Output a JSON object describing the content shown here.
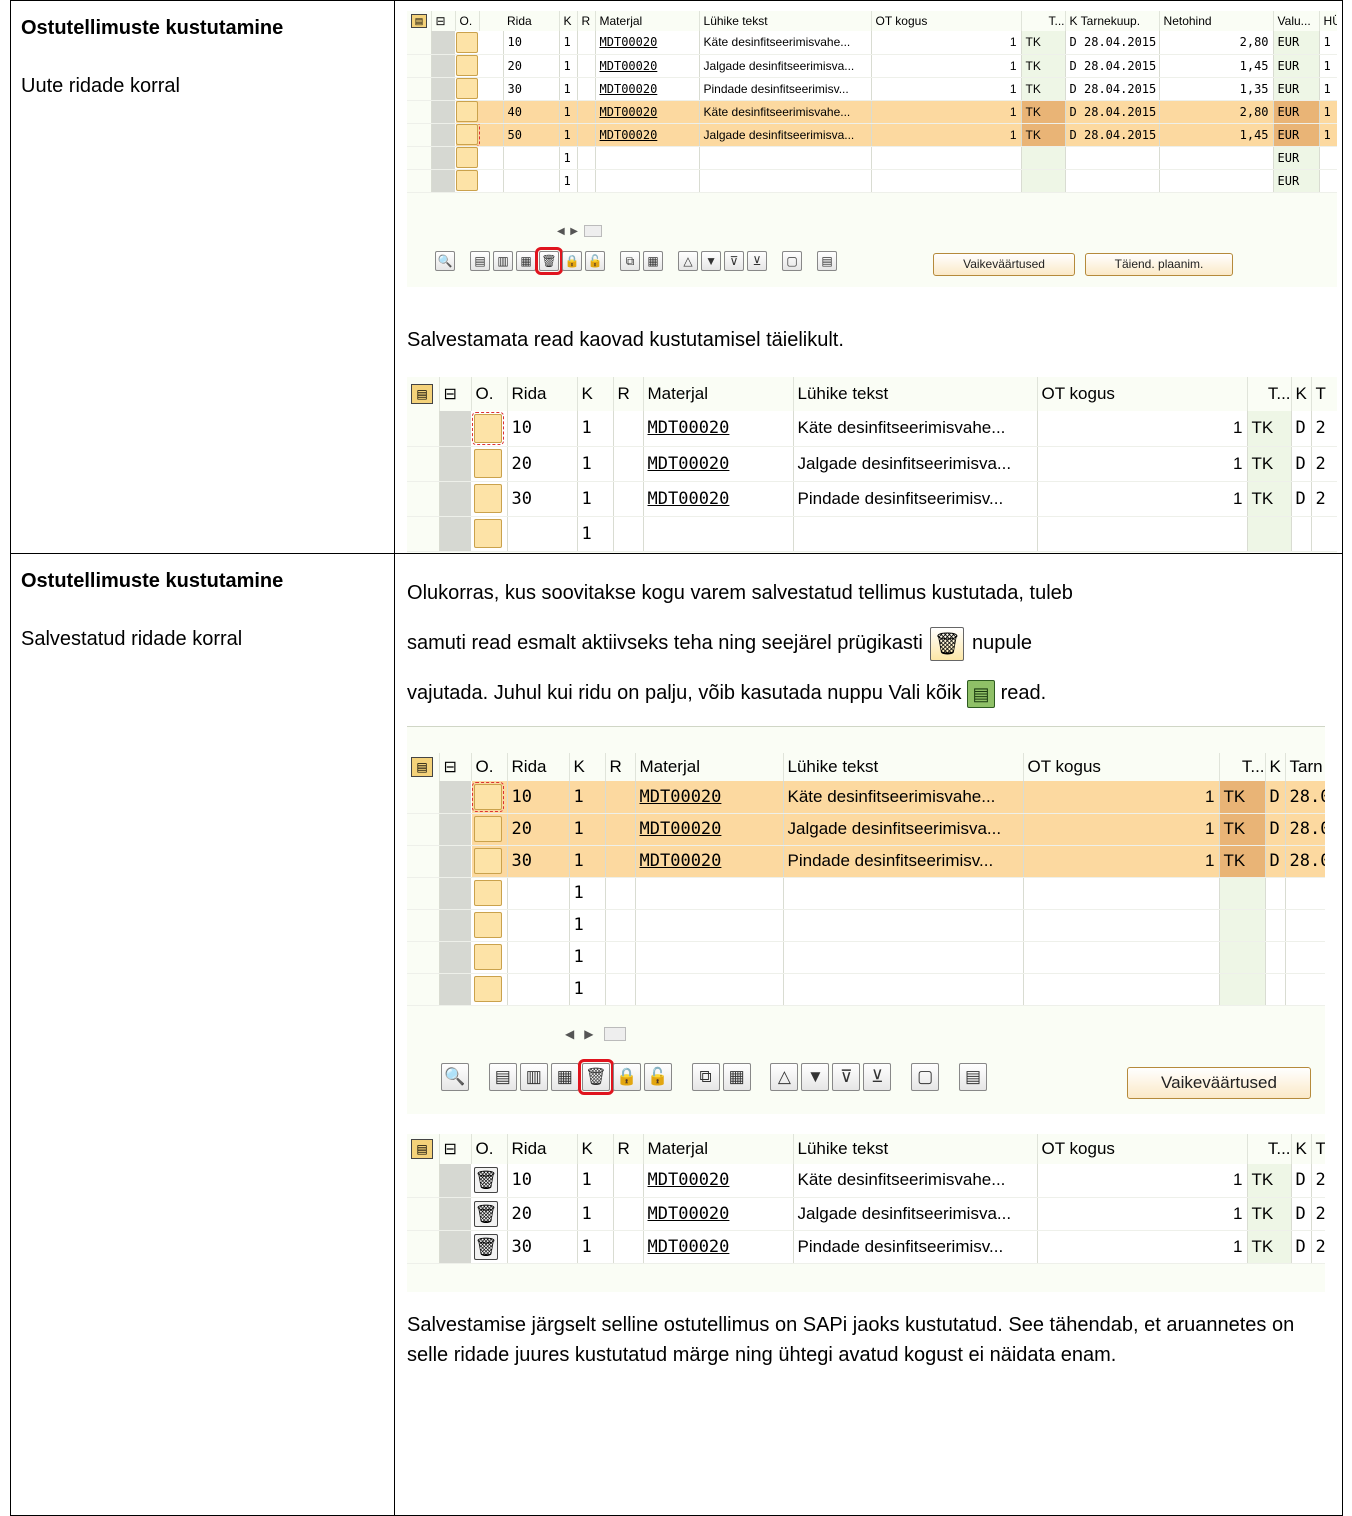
{
  "section1": {
    "title": "Ostutellimuste kustutamine",
    "subtitle": "Uute ridade korral",
    "grid": {
      "headers": [
        "O.",
        "Rida",
        "K",
        "R",
        "Materjal",
        "Lühike tekst",
        "OT kogus",
        "T...",
        "K",
        "Tarnekuup.",
        "Netohind",
        "Valu...",
        "HÜ"
      ],
      "rows": [
        {
          "rida": "10",
          "k": "1",
          "mat": "MDT00020",
          "text": "Käte desinfitseerimisvahe...",
          "qty": "1",
          "unit": "TK",
          "kk": "D",
          "date": "28.04.2015",
          "price": "2,80",
          "cur": "EUR",
          "hu": "1"
        },
        {
          "rida": "20",
          "k": "1",
          "mat": "MDT00020",
          "text": "Jalgade desinfitseerimisva...",
          "qty": "1",
          "unit": "TK",
          "kk": "D",
          "date": "28.04.2015",
          "price": "1,45",
          "cur": "EUR",
          "hu": "1"
        },
        {
          "rida": "30",
          "k": "1",
          "mat": "MDT00020",
          "text": "Pindade desinfitseerimisv...",
          "qty": "1",
          "unit": "TK",
          "kk": "D",
          "date": "28.04.2015",
          "price": "1,35",
          "cur": "EUR",
          "hu": "1"
        },
        {
          "rida": "40",
          "k": "1",
          "mat": "MDT00020",
          "text": "Käte desinfitseerimisvahe...",
          "qty": "1",
          "unit": "TK",
          "kk": "D",
          "date": "28.04.2015",
          "price": "2,80",
          "cur": "EUR",
          "hu": "1"
        },
        {
          "rida": "50",
          "k": "1",
          "mat": "MDT00020",
          "text": "Jalgade desinfitseerimisva...",
          "qty": "1",
          "unit": "TK",
          "kk": "D",
          "date": "28.04.2015",
          "price": "1,45",
          "cur": "EUR",
          "hu": "1"
        },
        {
          "rida": "",
          "k": "1",
          "mat": "",
          "text": "",
          "qty": "",
          "unit": "",
          "kk": "",
          "date": "",
          "price": "",
          "cur": "EUR",
          "hu": ""
        },
        {
          "rida": "",
          "k": "1",
          "mat": "",
          "text": "",
          "qty": "",
          "unit": "",
          "kk": "",
          "date": "",
          "price": "",
          "cur": "EUR",
          "hu": ""
        }
      ],
      "btn_defaults": "Vaikeväärtused",
      "btn_planning": "Täiend. plaanim."
    },
    "note": "Salvestamata read kaovad kustutamisel täielikult.",
    "grid2": {
      "headers": [
        "O.",
        "Rida",
        "K",
        "R",
        "Materjal",
        "Lühike tekst",
        "OT kogus",
        "T...",
        "K",
        "T"
      ],
      "rows": [
        {
          "rida": "10",
          "k": "1",
          "mat": "MDT00020",
          "text": "Käte desinfitseerimisvahe...",
          "qty": "1",
          "unit": "TK",
          "kk": "D",
          "t": "2"
        },
        {
          "rida": "20",
          "k": "1",
          "mat": "MDT00020",
          "text": "Jalgade desinfitseerimisva...",
          "qty": "1",
          "unit": "TK",
          "kk": "D",
          "t": "2"
        },
        {
          "rida": "30",
          "k": "1",
          "mat": "MDT00020",
          "text": "Pindade desinfitseerimisv...",
          "qty": "1",
          "unit": "TK",
          "kk": "D",
          "t": "2"
        },
        {
          "rida": "",
          "k": "1",
          "mat": "",
          "text": "",
          "qty": "",
          "unit": "",
          "kk": "",
          "t": ""
        }
      ]
    }
  },
  "section2": {
    "title": "Ostutellimuste kustutamine",
    "subtitle": "Salvestatud ridade korral",
    "para1a": "Olukorras, kus soovitakse kogu varem salvestatud tellimus kustutada, tuleb",
    "para1b": "samuti read esmalt aktiivseks teha ning seejärel prügikasti",
    "para1c": "nupule",
    "para1d": "vajutada. Juhul kui ridu on palju, võib kasutada nuppu Vali kõik",
    "para1e": "read.",
    "grid3": {
      "headers": [
        "O.",
        "Rida",
        "K",
        "R",
        "Materjal",
        "Lühike tekst",
        "OT kogus",
        "T...",
        "K",
        "Tarn"
      ],
      "rows": [
        {
          "rida": "10",
          "k": "1",
          "mat": "MDT00020",
          "text": "Käte desinfitseerimisvahe...",
          "qty": "1",
          "unit": "TK",
          "kk": "D",
          "date": "28.0"
        },
        {
          "rida": "20",
          "k": "1",
          "mat": "MDT00020",
          "text": "Jalgade desinfitseerimisva...",
          "qty": "1",
          "unit": "TK",
          "kk": "D",
          "date": "28.0"
        },
        {
          "rida": "30",
          "k": "1",
          "mat": "MDT00020",
          "text": "Pindade desinfitseerimisv...",
          "qty": "1",
          "unit": "TK",
          "kk": "D",
          "date": "28.0"
        },
        {
          "rida": "",
          "k": "1",
          "mat": "",
          "text": "",
          "qty": "",
          "unit": "",
          "kk": "",
          "date": ""
        },
        {
          "rida": "",
          "k": "1",
          "mat": "",
          "text": "",
          "qty": "",
          "unit": "",
          "kk": "",
          "date": ""
        },
        {
          "rida": "",
          "k": "1",
          "mat": "",
          "text": "",
          "qty": "",
          "unit": "",
          "kk": "",
          "date": ""
        },
        {
          "rida": "",
          "k": "1",
          "mat": "",
          "text": "",
          "qty": "",
          "unit": "",
          "kk": "",
          "date": ""
        }
      ],
      "btn_defaults": "Vaikeväärtused"
    },
    "grid4": {
      "headers": [
        "O.",
        "Rida",
        "K",
        "R",
        "Materjal",
        "Lühike tekst",
        "OT kogus",
        "T...",
        "K",
        "T"
      ],
      "rows": [
        {
          "rida": "10",
          "k": "1",
          "mat": "MDT00020",
          "text": "Käte desinfitseerimisvahe...",
          "qty": "1",
          "unit": "TK",
          "kk": "D",
          "t": "2"
        },
        {
          "rida": "20",
          "k": "1",
          "mat": "MDT00020",
          "text": "Jalgade desinfitseerimisva...",
          "qty": "1",
          "unit": "TK",
          "kk": "D",
          "t": "2"
        },
        {
          "rida": "30",
          "k": "1",
          "mat": "MDT00020",
          "text": "Pindade desinfitseerimisv...",
          "qty": "1",
          "unit": "TK",
          "kk": "D",
          "t": "2"
        }
      ]
    },
    "para2": "Salvestamise järgselt selline ostutellimus on SAPi jaoks kustutatud. See tähendab, et aruannetes on selle ridade juures kustutatud märge ning ühtegi avatud kogust ei näidata enam."
  },
  "icons": {
    "trash": "trash-icon",
    "select_all": "select-all-icon"
  }
}
